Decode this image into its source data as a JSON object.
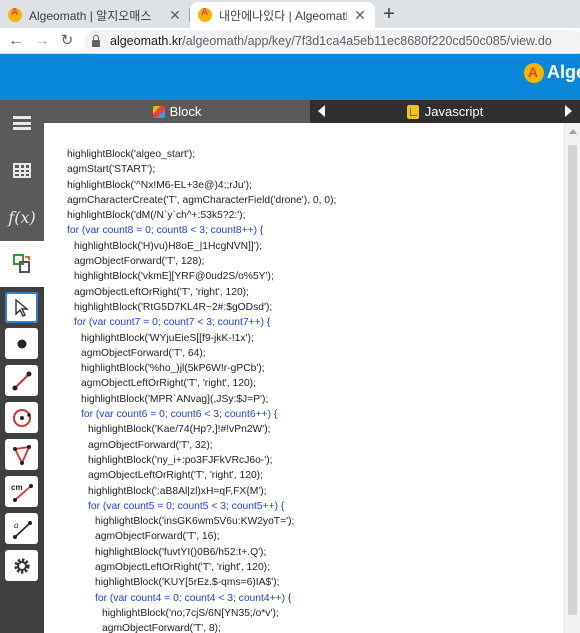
{
  "browser": {
    "tabs": [
      {
        "title": "Algeomath | 알지오매스",
        "close": "✕",
        "active": false
      },
      {
        "title": "내안에나있다 | Algeomath | 알지",
        "close": "✕",
        "active": true
      }
    ],
    "new_tab_label": "+",
    "url_host": "algeomath.kr",
    "url_path": "/algeomath/app/key/7f3d1ca4a5eb11ec8680f220cd50c085/view.do"
  },
  "app": {
    "brand": "Algeo",
    "accent_color": "#0b87d9"
  },
  "sidebar": {
    "function_label": "f(x)",
    "buttons": [
      "menu-icon",
      "table-icon",
      "function-icon",
      "tools-toggle-icon"
    ],
    "tools": [
      "select-arrow-tool",
      "point-tool",
      "segment-tool",
      "circle-tool",
      "polygon-tool",
      "measure-length-tool",
      "measure-angle-tool",
      "settings-tool"
    ],
    "measure_label": "cm"
  },
  "editor": {
    "block_tab": "Block",
    "js_tab": "Javascript",
    "lines": [
      {
        "indent": 0,
        "text": "highlightBlock('algeo_start');",
        "kw": false
      },
      {
        "indent": 0,
        "text": "agmStart('START');",
        "kw": false
      },
      {
        "indent": 0,
        "text": "highlightBlock('^Nx!M6-EL+3e@)4;;rJu');",
        "kw": false
      },
      {
        "indent": 0,
        "text": "agmCharacterCreate('T', agmCharacterField('drone'), 0, 0);",
        "kw": false
      },
      {
        "indent": 0,
        "text": "highlightBlock('dM(/N`y`ch^+:53k5?2:');",
        "kw": false
      },
      {
        "indent": 0,
        "text": "for (var count8 = 0; count8 < 3; count8++) {",
        "kw": true
      },
      {
        "indent": 1,
        "text": "highlightBlock('H)vu)H8oE_|1HcgNVN]]');",
        "kw": false
      },
      {
        "indent": 1,
        "text": "agmObjectForward('T', 128);",
        "kw": false
      },
      {
        "indent": 1,
        "text": "highlightBlock('vkmE][YRF@0ud2S/o%5Y');",
        "kw": false
      },
      {
        "indent": 1,
        "text": "agmObjectLeftOrRight('T', 'right', 120);",
        "kw": false
      },
      {
        "indent": 1,
        "text": "highlightBlock('RtG5D7KL4R~2#:$gODsd');",
        "kw": false
      },
      {
        "indent": 1,
        "text": "for (var count7 = 0; count7 < 3; count7++) {",
        "kw": true
      },
      {
        "indent": 2,
        "text": "highlightBlock('WYjuEieS[[f9-jkK-!1x');",
        "kw": false
      },
      {
        "indent": 2,
        "text": "agmObjectForward('T', 64);",
        "kw": false
      },
      {
        "indent": 2,
        "text": "highlightBlock('%ho_)jl(5kP6W!r-gPCb');",
        "kw": false
      },
      {
        "indent": 2,
        "text": "agmObjectLeftOrRight('T', 'right', 120);",
        "kw": false
      },
      {
        "indent": 2,
        "text": "highlightBlock('MPR`ANvag](,JSy:$J=P');",
        "kw": false
      },
      {
        "indent": 2,
        "text": "for (var count6 = 0; count6 < 3; count6++) {",
        "kw": true
      },
      {
        "indent": 3,
        "text": "highlightBlock('Kae/74(Hp?,]!#!vPn2W');",
        "kw": false
      },
      {
        "indent": 3,
        "text": "agmObjectForward('T', 32);",
        "kw": false
      },
      {
        "indent": 3,
        "text": "highlightBlock('ny_i+:po3FJFkVRcJ6o-');",
        "kw": false
      },
      {
        "indent": 3,
        "text": "agmObjectLeftOrRight('T', 'right', 120);",
        "kw": false
      },
      {
        "indent": 3,
        "text": "highlightBlock(':aB8Al|zl)xH=qF,FX{M');",
        "kw": false
      },
      {
        "indent": 3,
        "text": "for (var count5 = 0; count5 < 3; count5++) {",
        "kw": true
      },
      {
        "indent": 4,
        "text": "highlightBlock('insGK6wm5V6u:KW2yoT=');",
        "kw": false
      },
      {
        "indent": 4,
        "text": "agmObjectForward('T', 16);",
        "kw": false
      },
      {
        "indent": 4,
        "text": "highlightBlock('fuvtYI()0B6/h52:t+.Q');",
        "kw": false
      },
      {
        "indent": 4,
        "text": "agmObjectLeftOrRight('T', 'right', 120);",
        "kw": false
      },
      {
        "indent": 4,
        "text": "highlightBlock('KUY[5rEz.$-qms=6)IA$');",
        "kw": false
      },
      {
        "indent": 4,
        "text": "for (var count4 = 0; count4 < 3; count4++) {",
        "kw": true
      },
      {
        "indent": 5,
        "text": "highlightBlock('no;7cjS/6N[YN35;/o*v');",
        "kw": false
      },
      {
        "indent": 5,
        "text": "agmObjectForward('T', 8);",
        "kw": false
      }
    ]
  }
}
